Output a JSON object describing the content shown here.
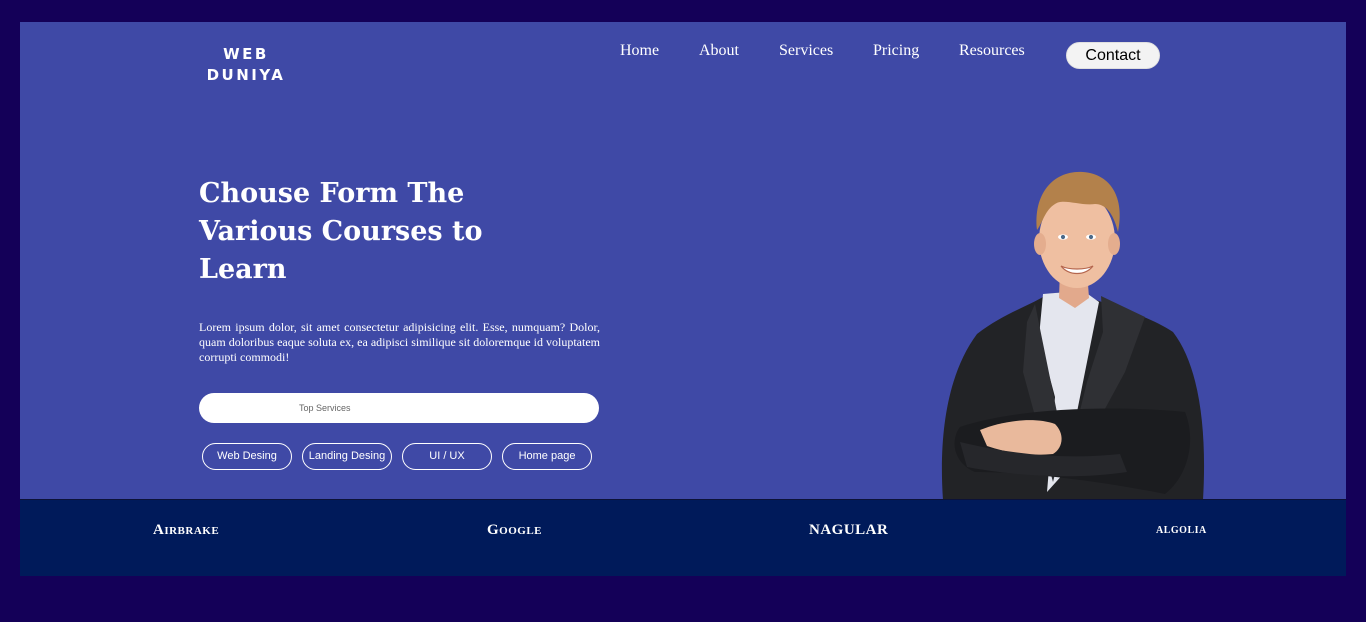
{
  "header": {
    "logo_line1": "WEB",
    "logo_line2": "DUNIYA",
    "nav": [
      "Home",
      "About",
      "Services",
      "Pricing",
      "Resources"
    ],
    "contact_label": "Contact"
  },
  "hero": {
    "headline": "Chouse Form The Various Courses to Learn",
    "body": "Lorem ipsum dolor, sit amet consectetur adipisicing elit. Esse, numquam? Dolor, quam doloribus eaque soluta ex, ea adipisci similique sit doloremque id voluptatem corrupti commodi!",
    "search_placeholder": "Top Services",
    "chips": [
      "Web Desing",
      "Landing Desing",
      "UI / UX",
      "Home page"
    ]
  },
  "partners": [
    "Airbrake",
    "Google",
    "NAGULAR",
    "algolia"
  ],
  "colors": {
    "page_bg": "#140058",
    "hero_bg": "#3f49a6",
    "partner_strip": "#001a5a",
    "text": "#ffffff"
  },
  "icons": [
    "person-photo"
  ]
}
